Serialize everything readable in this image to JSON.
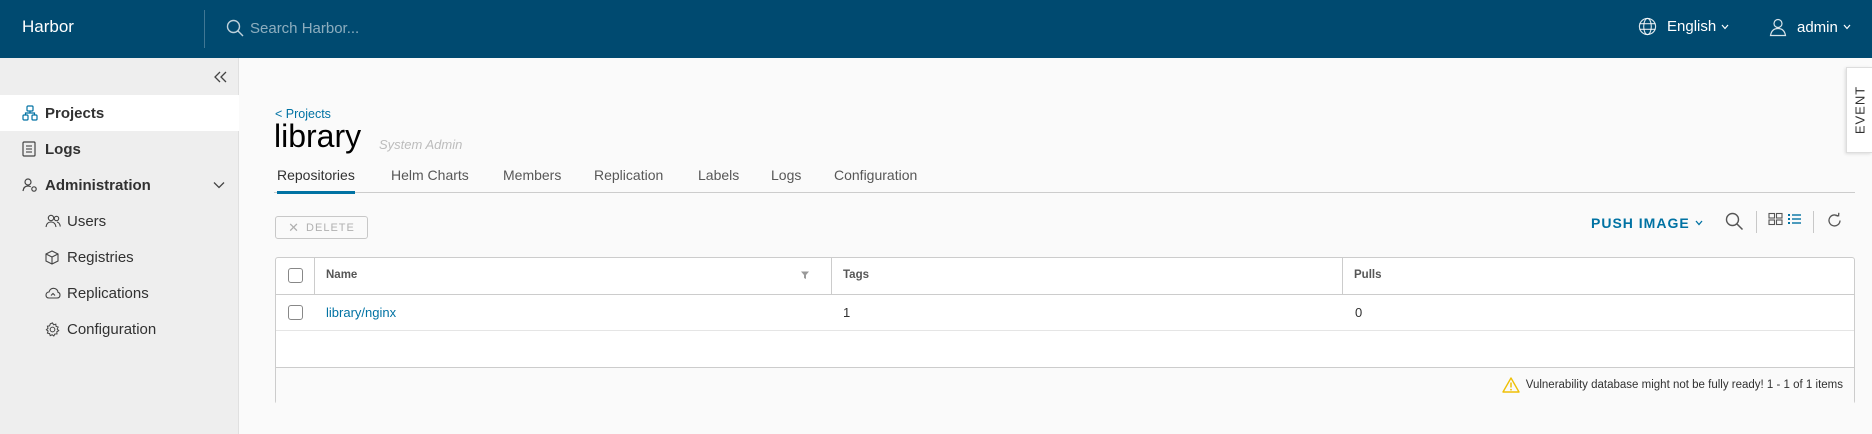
{
  "header": {
    "brand": "Harbor",
    "search_placeholder": "Search Harbor...",
    "language": "English",
    "user": "admin"
  },
  "sidebar": {
    "items": [
      {
        "label": "Projects",
        "icon": "projects-icon",
        "active": true
      },
      {
        "label": "Logs",
        "icon": "logs-icon"
      },
      {
        "label": "Administration",
        "icon": "administration-icon"
      },
      {
        "label": "Users",
        "icon": "users-icon"
      },
      {
        "label": "Registries",
        "icon": "registries-icon"
      },
      {
        "label": "Replications",
        "icon": "replications-icon"
      },
      {
        "label": "Configuration",
        "icon": "configuration-icon"
      }
    ]
  },
  "event_tab": "EVENT",
  "breadcrumb": "< Projects",
  "page": {
    "title": "library",
    "role": "System Admin"
  },
  "tabs": [
    {
      "label": "Repositories",
      "active": true
    },
    {
      "label": "Helm Charts"
    },
    {
      "label": "Members"
    },
    {
      "label": "Replication"
    },
    {
      "label": "Labels"
    },
    {
      "label": "Logs"
    },
    {
      "label": "Configuration"
    }
  ],
  "toolbar": {
    "delete_label": "DELETE",
    "push_image_label": "PUSH IMAGE"
  },
  "table": {
    "columns": [
      "Name",
      "Tags",
      "Pulls"
    ],
    "rows": [
      {
        "name": "library/nginx",
        "tags": "1",
        "pulls": "0"
      }
    ],
    "footer": "Vulnerability database might not be fully ready! 1 - 1 of 1 items"
  },
  "colors": {
    "header_bg": "#004a70",
    "accent": "#0072a3",
    "warning": "#efc006"
  }
}
